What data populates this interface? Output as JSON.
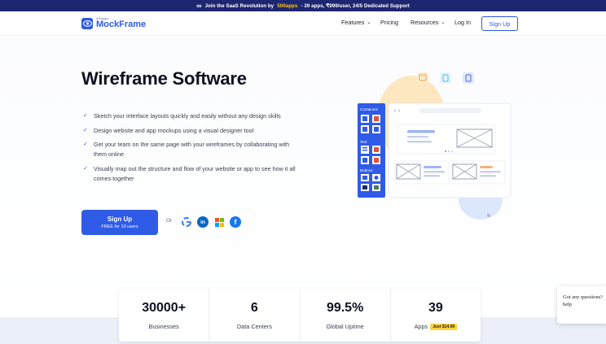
{
  "banner": {
    "prefix": "Join the SaaS Revolution by",
    "brand": "500apps",
    "suffix": "- 39 apps, ₹999/user, 24/5 Dedicated Support",
    "icon": "infinity-icon"
  },
  "header": {
    "logo_sub": "500apps",
    "logo_name": "MockFrame",
    "nav": [
      "Features",
      "Pricing",
      "Resources",
      "Log In"
    ],
    "signup": "Sign Up"
  },
  "hero": {
    "title": "Wireframe Software",
    "features": [
      "Sketch your interface layouts quickly and easily without any design skills",
      "Design website and app mockups using a visual designer tool",
      "Get your team on the same page with your wireframes by collaborating with them online",
      "Visually map out the structure and flow of your website or app to see how it all comes together"
    ],
    "cta_main": "Sign Up",
    "cta_sub": "FREE for 10 users",
    "or": "Or",
    "social": [
      "google-icon",
      "linkedin-icon",
      "microsoft-icon",
      "facebook-icon"
    ]
  },
  "illustration": {
    "panel_sections": [
      "Containers",
      "Text",
      "Buttons"
    ]
  },
  "stats": [
    {
      "value": "30000+",
      "label": "Businesses"
    },
    {
      "value": "6",
      "label": "Data Centers"
    },
    {
      "value": "99.5%",
      "label": "Global Uptime"
    },
    {
      "value": "39",
      "label": "Apps",
      "badge": "Just $14.99"
    }
  ],
  "chat": {
    "line1": "Got any questions?",
    "line2": "help"
  },
  "colors": {
    "accent": "#2f5be7",
    "banner": "#1d2670",
    "highlight": "#ffc21c",
    "badge": "#ffd23f"
  }
}
